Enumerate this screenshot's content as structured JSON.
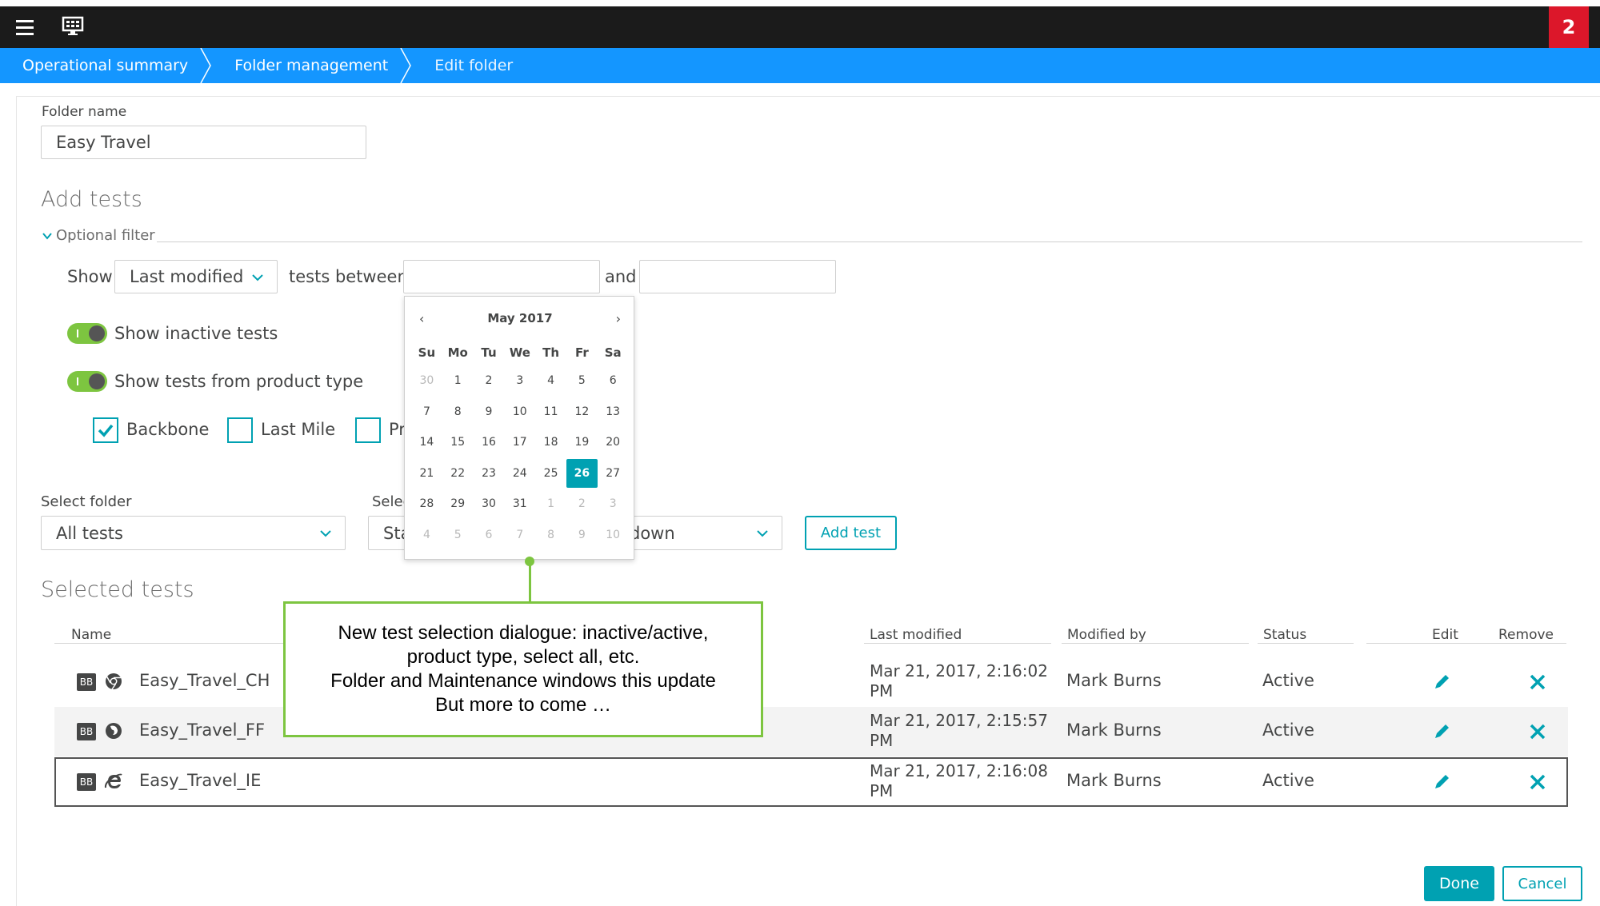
{
  "topbar": {
    "notification_count": "2"
  },
  "breadcrumb": [
    "Operational summary",
    "Folder management",
    "Edit folder"
  ],
  "folder_name": {
    "label": "Folder name",
    "value": "Easy Travel"
  },
  "add_tests": {
    "heading": "Add tests",
    "optional_filter": "Optional filter",
    "show_label": "Show",
    "show_select": "Last modified",
    "between_label": "tests between",
    "and_label": "and",
    "start_date": "",
    "end_date": "",
    "toggle_inactive": "Show inactive tests",
    "toggle_product": "Show tests from product type",
    "checkbox_backbone": "Backbone",
    "checkbox_lastmile": "Last Mile",
    "checkbox_third": "Pr",
    "select_folder_label": "Select folder",
    "select_folder_value": "All tests",
    "select_second_label": "Selec",
    "select_second_value": "Sta",
    "select_third_value": "down",
    "add_test_button": "Add test"
  },
  "calendar": {
    "title": "May 2017",
    "prev": "‹",
    "next": "›",
    "dow": [
      "Su",
      "Mo",
      "Tu",
      "We",
      "Th",
      "Fr",
      "Sa"
    ],
    "weeks": [
      [
        {
          "d": "30",
          "m": true
        },
        {
          "d": "1"
        },
        {
          "d": "2"
        },
        {
          "d": "3"
        },
        {
          "d": "4"
        },
        {
          "d": "5"
        },
        {
          "d": "6"
        }
      ],
      [
        {
          "d": "7"
        },
        {
          "d": "8"
        },
        {
          "d": "9"
        },
        {
          "d": "10"
        },
        {
          "d": "11"
        },
        {
          "d": "12"
        },
        {
          "d": "13"
        }
      ],
      [
        {
          "d": "14"
        },
        {
          "d": "15"
        },
        {
          "d": "16"
        },
        {
          "d": "17"
        },
        {
          "d": "18"
        },
        {
          "d": "19"
        },
        {
          "d": "20"
        }
      ],
      [
        {
          "d": "21"
        },
        {
          "d": "22"
        },
        {
          "d": "23"
        },
        {
          "d": "24"
        },
        {
          "d": "25"
        },
        {
          "d": "26",
          "s": true
        },
        {
          "d": "27"
        }
      ],
      [
        {
          "d": "28"
        },
        {
          "d": "29"
        },
        {
          "d": "30"
        },
        {
          "d": "31"
        },
        {
          "d": "1",
          "m": true
        },
        {
          "d": "2",
          "m": true
        },
        {
          "d": "3",
          "m": true
        }
      ],
      [
        {
          "d": "4",
          "m": true
        },
        {
          "d": "5",
          "m": true
        },
        {
          "d": "6",
          "m": true
        },
        {
          "d": "7",
          "m": true
        },
        {
          "d": "8",
          "m": true
        },
        {
          "d": "9",
          "m": true
        },
        {
          "d": "10",
          "m": true
        }
      ]
    ]
  },
  "callout": {
    "lines": [
      "New test selection dialogue: inactive/active,",
      "product type, select all, etc.",
      "Folder and Maintenance windows this update",
      "But more to come …"
    ]
  },
  "selected_tests": {
    "heading": "Selected tests",
    "columns": {
      "name": "Name",
      "last_modified": "Last modified",
      "modified_by": "Modified by",
      "status": "Status",
      "edit": "Edit",
      "remove": "Remove"
    },
    "rows": [
      {
        "badge": "BB",
        "browser": "chrome-icon",
        "name": "Easy_Travel_CH",
        "date1": "Mar 21, 2017, 2:16:02",
        "date2": "PM",
        "by": "Mark Burns",
        "status": "Active"
      },
      {
        "badge": "BB",
        "browser": "firefox-icon",
        "name": "Easy_Travel_FF",
        "date1": "Mar 21, 2017, 2:15:57",
        "date2": "PM",
        "by": "Mark Burns",
        "status": "Active"
      },
      {
        "badge": "BB",
        "browser": "ie-icon",
        "name": "Easy_Travel_IE",
        "date1": "Mar 21, 2017, 2:16:08",
        "date2": "PM",
        "by": "Mark Burns",
        "status": "Active"
      }
    ]
  },
  "footer": {
    "done": "Done",
    "cancel": "Cancel"
  },
  "colors": {
    "accent": "#00a1b2",
    "breadcrumb": "#1496ff",
    "toggle_on": "#7dc540",
    "badge": "#dc172a"
  }
}
